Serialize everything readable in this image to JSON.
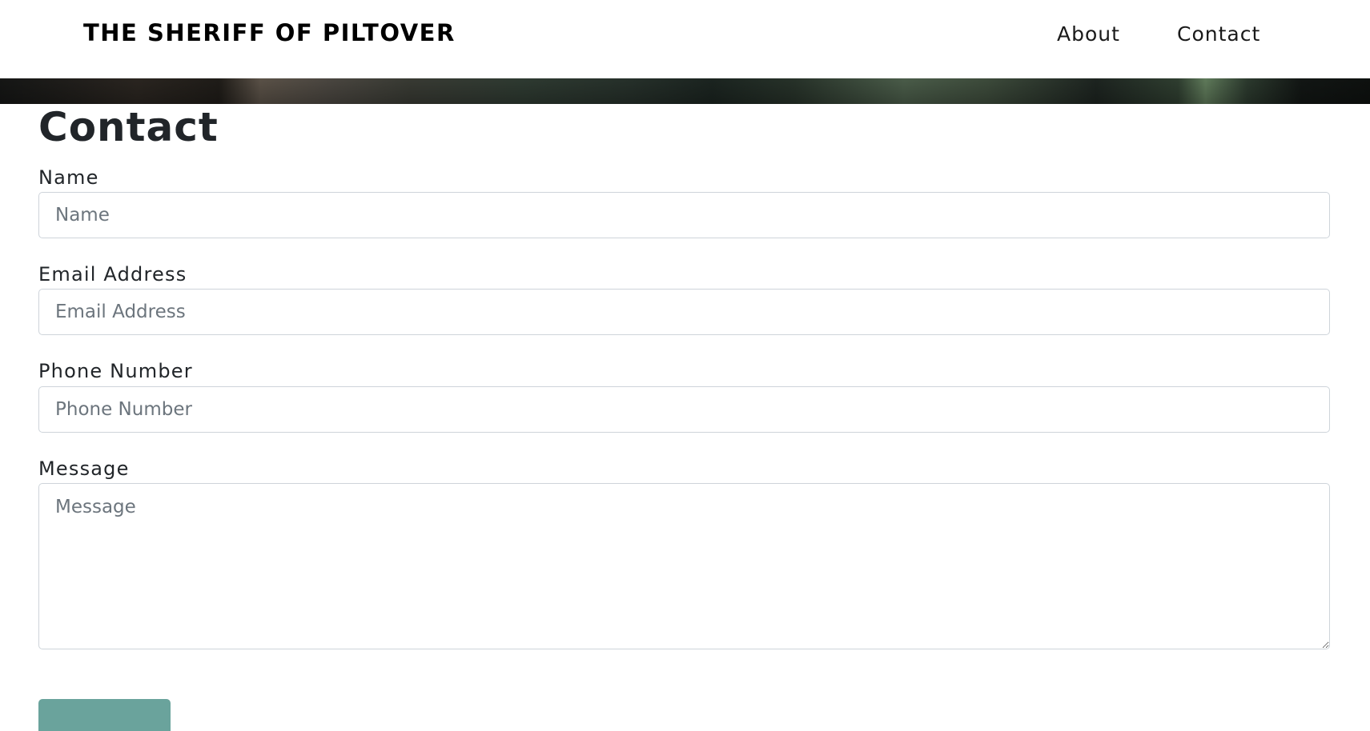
{
  "navbar": {
    "brand": "The Sheriff of Piltover",
    "links": [
      {
        "label": "About"
      },
      {
        "label": "Contact"
      }
    ]
  },
  "banner": {
    "colors": [
      "#151615",
      "#5a5147",
      "#2e3a31",
      "#5f7a5a",
      "#0e110f"
    ]
  },
  "form": {
    "title": "Contact",
    "name": {
      "label": "Name",
      "placeholder": "Name",
      "value": ""
    },
    "email": {
      "label": "Email Address",
      "placeholder": "Email Address",
      "value": ""
    },
    "phone": {
      "label": "Phone Number",
      "placeholder": "Phone Number",
      "value": ""
    },
    "message": {
      "label": "Message",
      "placeholder": "Message",
      "value": ""
    },
    "submit": {
      "label": "",
      "color": "#6aa39c"
    }
  }
}
